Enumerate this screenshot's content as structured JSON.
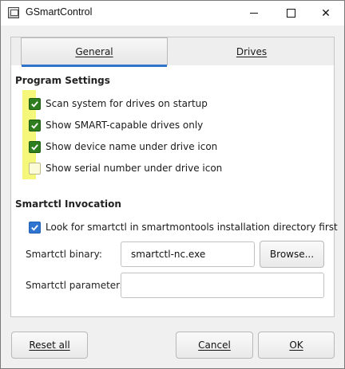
{
  "window": {
    "title": "GSmartControl"
  },
  "tabs": [
    {
      "label": "General",
      "active": true
    },
    {
      "label": "Drives",
      "active": false
    }
  ],
  "program_settings": {
    "title": "Program Settings",
    "options": [
      {
        "label": "Scan system for drives on startup",
        "checked": true
      },
      {
        "label": "Show SMART-capable drives only",
        "checked": true
      },
      {
        "label": "Show device name under drive icon",
        "checked": true
      },
      {
        "label": "Show serial number under drive icon",
        "checked": false
      }
    ]
  },
  "smartctl": {
    "title": "Smartctl Invocation",
    "look_option": {
      "label": "Look for smartctl in smartmontools installation directory first",
      "checked": true
    },
    "binary_label": "Smartctl binary:",
    "binary_value": "smartctl-nc.exe",
    "browse_label": "Browse...",
    "parameters_label": "Smartctl parameters:",
    "parameters_value": ""
  },
  "footer": {
    "reset_label": "Reset all",
    "cancel_label": "Cancel",
    "ok_label": "OK"
  },
  "colors": {
    "accent": "#2d73c9",
    "checkbox_green": "#2e7d1e",
    "checkbox_blue": "#2f74cf",
    "highlight": "#f5f77b"
  }
}
